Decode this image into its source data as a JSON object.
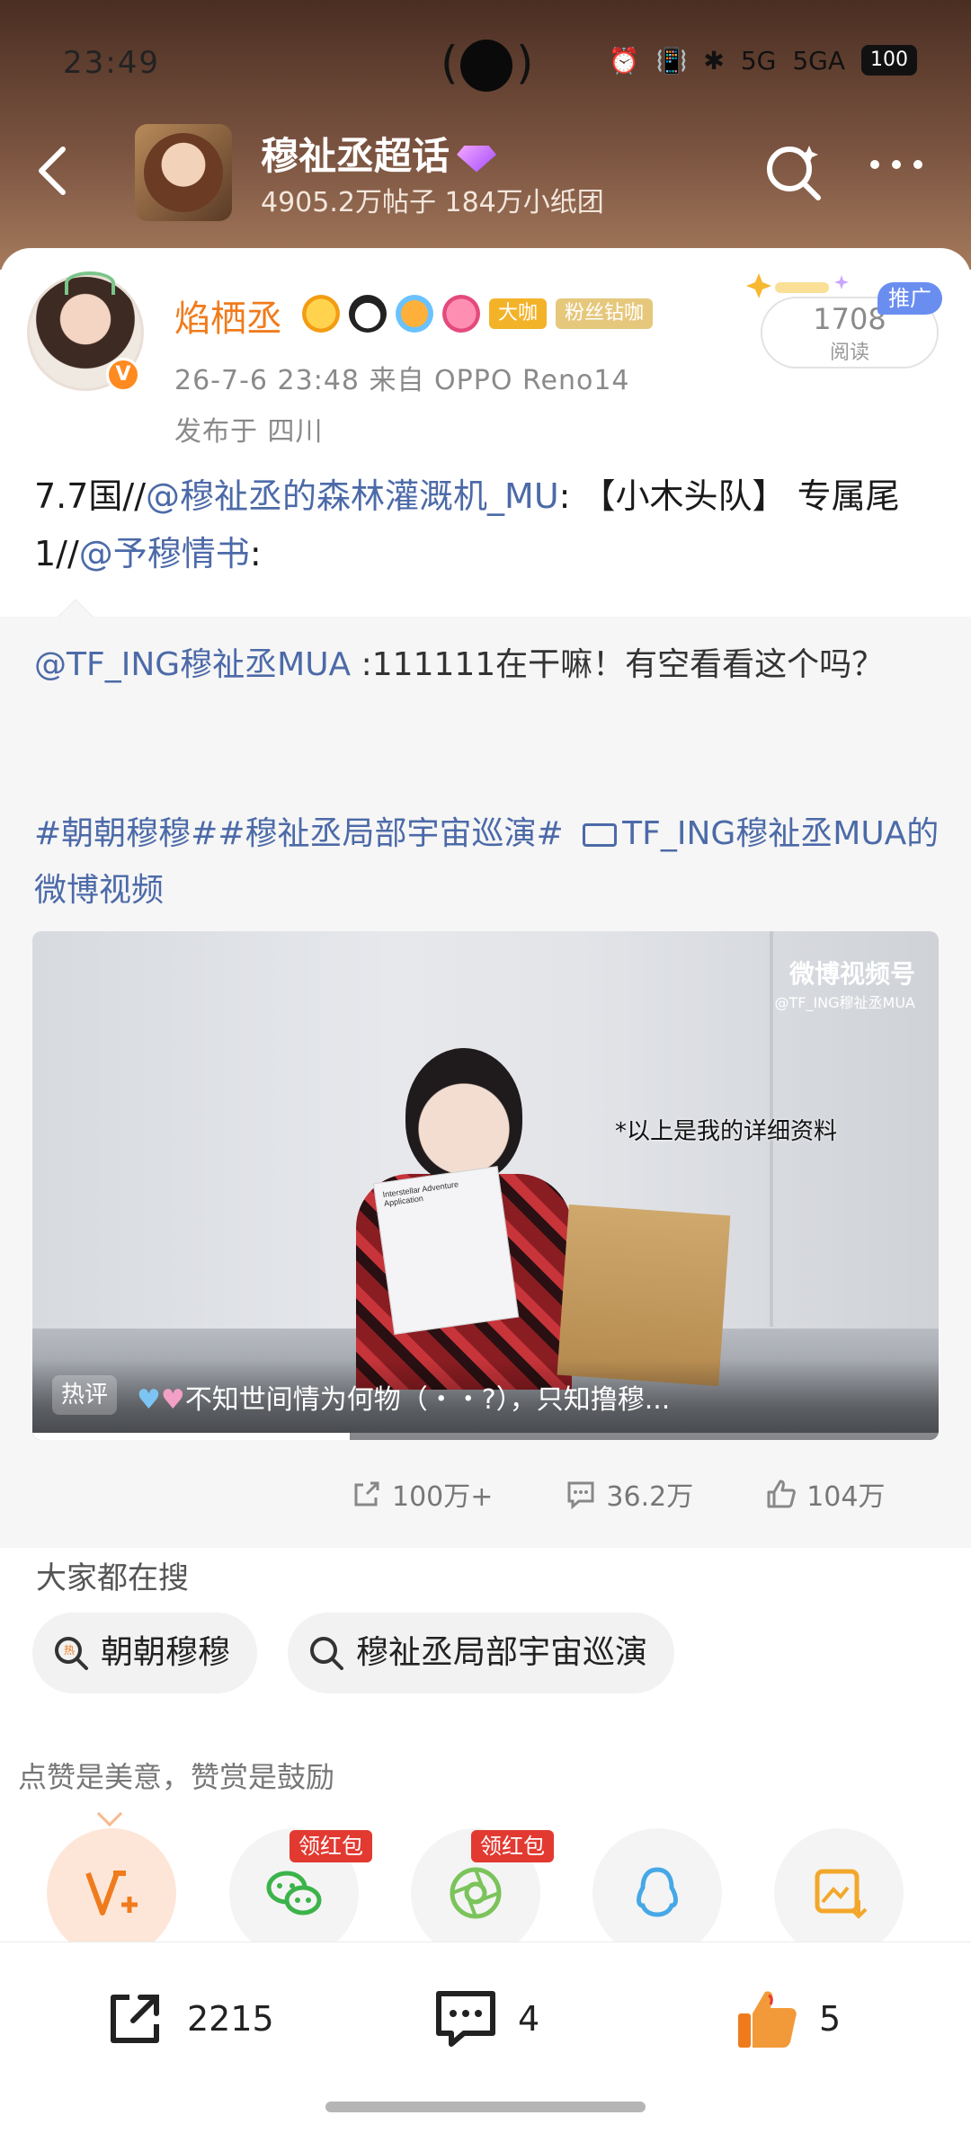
{
  "status": {
    "time": "23:49",
    "signal1": "5G",
    "signal2": "5GA",
    "battery": "100"
  },
  "topic": {
    "title": "穆祉丞超话",
    "stats": "4905.2万帖子 184万小纸团"
  },
  "author": {
    "name": "焰栖丞",
    "tag1": "大咖",
    "tag2": "粉丝钻咖",
    "meta": "26-7-6 23:48  来自 OPPO Reno14",
    "location": "发布于 四川"
  },
  "read": {
    "count": "1708",
    "label": "阅读",
    "promo": "推广"
  },
  "post": {
    "prefix": "7.7国//",
    "mention1": "@穆祉丞的森林灌溉机_MU",
    "mid": ": 【小木头队】 专属尾1//",
    "mention2": "@予穆情书",
    "suffix": ":"
  },
  "repost": {
    "mention": "@TF_ING穆祉丞MUA",
    "text": " :111111在干嘛！有空看看这个吗？",
    "hashtags": "#朝朝穆穆##穆祉丞局部宇宙巡演#",
    "video_link": "TF_ING穆祉丞MUA的微博视频"
  },
  "video": {
    "watermark_main": "微博视频号",
    "watermark_sub": "@TF_ING穆祉丞MUA",
    "caption": "*以上是我的详细资料",
    "paper_title": "Interstellar Adventure Application",
    "hot_tag": "热评",
    "hot_text": "不知世间情为何物（・・?），只知撸穆...",
    "progress": 0.35
  },
  "stats": {
    "reposts": "100万+",
    "comments": "36.2万",
    "likes": "104万"
  },
  "search": {
    "label": "大家都在搜",
    "pill1": "朝朝穆穆",
    "pill2": "穆祉丞局部宇宙巡演"
  },
  "like_prompt": "点赞是美意，赞赏是鼓励",
  "share": {
    "redpack1": "领红包",
    "redpack2": "领红包"
  },
  "bottom": {
    "reposts": "2215",
    "comments": "4",
    "likes": "5"
  },
  "colors": {
    "accent": "#f07b1c",
    "link": "#4c6aa8",
    "redpack": "#e23a31"
  }
}
